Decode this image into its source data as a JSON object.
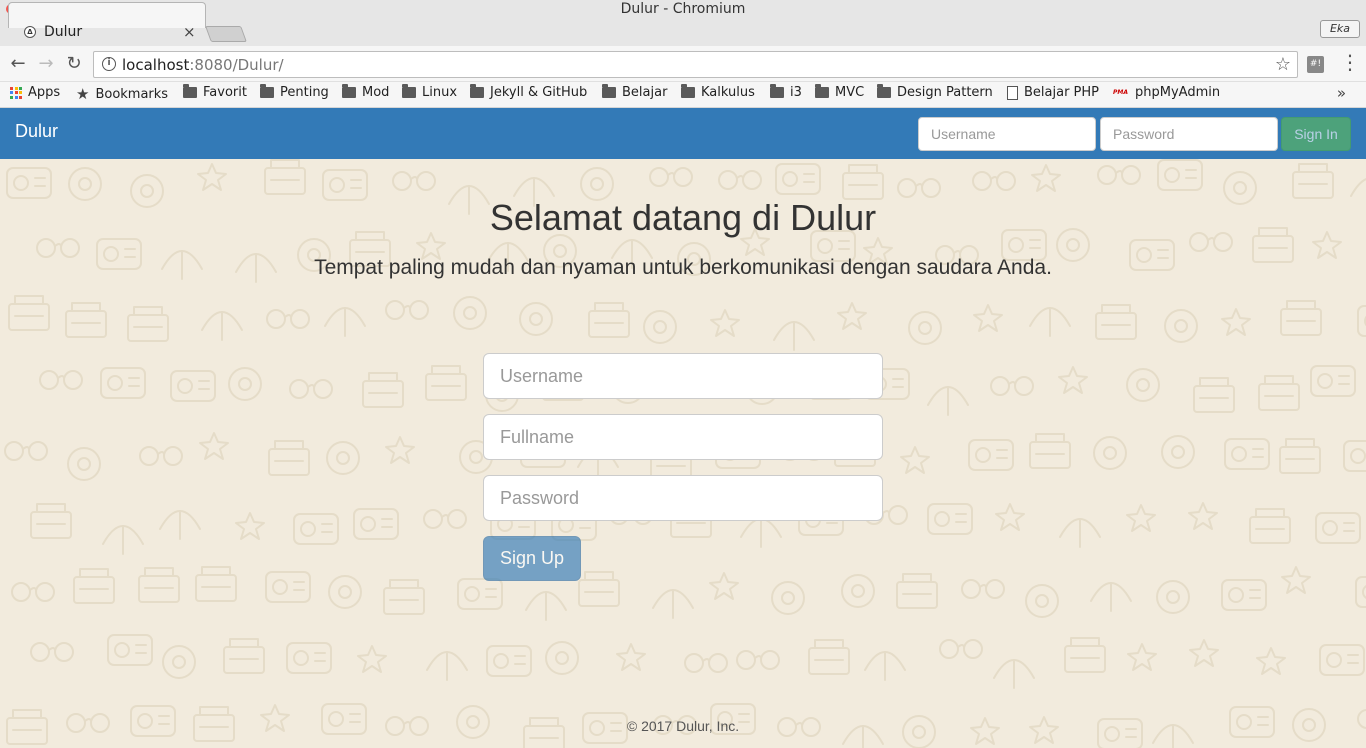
{
  "window": {
    "title": "Dulur - Chromium"
  },
  "tab": {
    "label": "Dulur",
    "close": "×"
  },
  "profile": {
    "label": "Eka"
  },
  "omnibox": {
    "host": "localhost",
    "rest": ":8080/Dulur/"
  },
  "bookmarks": {
    "items": [
      {
        "label": "Apps",
        "icon": "apps-icon"
      },
      {
        "label": "Bookmarks",
        "icon": "star-icon"
      },
      {
        "label": "Favorit",
        "icon": "folder-icon"
      },
      {
        "label": "Penting",
        "icon": "folder-icon"
      },
      {
        "label": "Mod",
        "icon": "folder-icon"
      },
      {
        "label": "Linux",
        "icon": "folder-icon"
      },
      {
        "label": "Jekyll & GitHub",
        "icon": "folder-icon"
      },
      {
        "label": "Belajar",
        "icon": "folder-icon"
      },
      {
        "label": "Kalkulus",
        "icon": "folder-icon"
      },
      {
        "label": "i3",
        "icon": "folder-icon"
      },
      {
        "label": "MVC",
        "icon": "folder-icon"
      },
      {
        "label": "Design Pattern",
        "icon": "folder-icon"
      },
      {
        "label": "Belajar PHP",
        "icon": "page-icon"
      },
      {
        "label": "phpMyAdmin",
        "icon": "pma-icon"
      }
    ],
    "overflow": "»"
  },
  "navbar": {
    "brand": "Dulur",
    "username_placeholder": "Username",
    "password_placeholder": "Password",
    "signin_label": "Sign In"
  },
  "hero": {
    "title": "Selamat datang di Dulur",
    "subtitle": "Tempat paling mudah dan nyaman untuk berkomunikasi dengan saudara Anda."
  },
  "signup_form": {
    "username_placeholder": "Username",
    "fullname_placeholder": "Fullname",
    "password_placeholder": "Password",
    "submit_label": "Sign Up"
  },
  "footer": {
    "text": "© 2017 Dulur, Inc."
  },
  "colors": {
    "navbar": "#337ab7",
    "signin": "#5cb85c",
    "background": "#f2ebdd",
    "doodle": "#e5dcc8"
  }
}
